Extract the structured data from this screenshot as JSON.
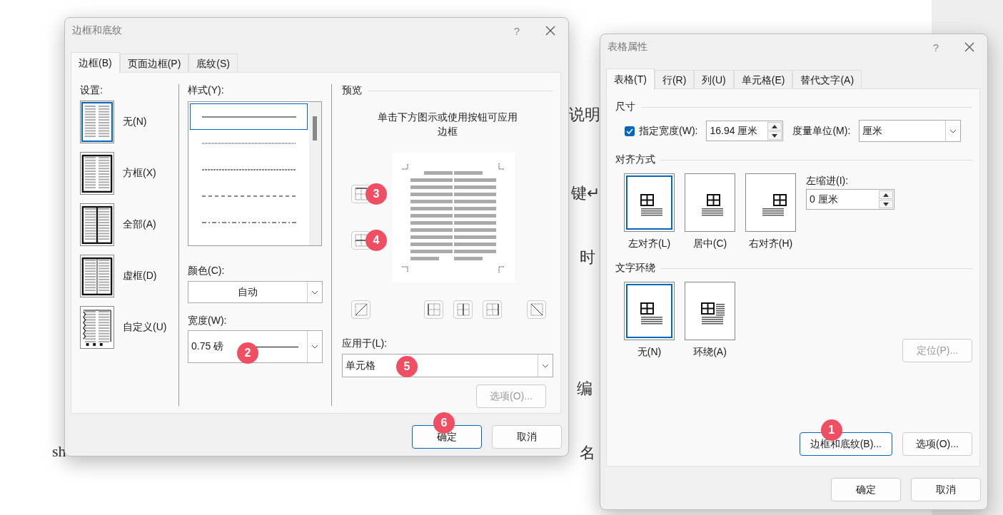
{
  "document": {
    "fragments": [
      "说明",
      "键↵",
      "时",
      "编",
      "sh",
      "名"
    ]
  },
  "border_dialog": {
    "title": "边框和底纹",
    "help": "?",
    "tabs": [
      {
        "label": "边框(B)",
        "selected": true
      },
      {
        "label": "页面边框(P)",
        "selected": false
      },
      {
        "label": "底纹(S)",
        "selected": false
      }
    ],
    "settings": {
      "label": "设置:",
      "items": [
        {
          "label": "无(N)",
          "kind": "none",
          "selected": true
        },
        {
          "label": "方框(X)",
          "kind": "box",
          "selected": false
        },
        {
          "label": "全部(A)",
          "kind": "all",
          "selected": false
        },
        {
          "label": "虚框(D)",
          "kind": "grid",
          "selected": false
        },
        {
          "label": "自定义(U)",
          "kind": "custom",
          "selected": false
        }
      ]
    },
    "style": {
      "label": "样式(Y):",
      "lines": [
        {
          "kind": "solid",
          "selected": true
        },
        {
          "kind": "dotted",
          "selected": false
        },
        {
          "kind": "fine-dash",
          "selected": false
        },
        {
          "kind": "dashed",
          "selected": false
        },
        {
          "kind": "dash-dot",
          "selected": false
        }
      ]
    },
    "color": {
      "label": "颜色(C):",
      "value": "自动"
    },
    "width": {
      "label": "宽度(W):",
      "value": "0.75 磅",
      "badge": "2"
    },
    "preview": {
      "label": "预览",
      "hint": "单击下方图示或使用按钮可应用边框",
      "side_buttons": [
        {
          "kind": "top",
          "badge": "3"
        },
        {
          "kind": "inner-horizontal",
          "badge": "4"
        }
      ]
    },
    "apply_to": {
      "label": "应用于(L):",
      "value": "单元格",
      "badge": "5"
    },
    "options_button": {
      "label": "选项(O)...",
      "disabled": true
    },
    "buttons": [
      {
        "label": "确定",
        "default": true,
        "badge": "6"
      },
      {
        "label": "取消",
        "default": false
      }
    ]
  },
  "table_dialog": {
    "title": "表格属性",
    "help": "?",
    "tabs": [
      {
        "label": "表格(T)",
        "selected": true
      },
      {
        "label": "行(R)",
        "selected": false
      },
      {
        "label": "列(U)",
        "selected": false
      },
      {
        "label": "单元格(E)",
        "selected": false
      },
      {
        "label": "替代文字(A)",
        "selected": false
      }
    ],
    "size": {
      "heading": "尺寸",
      "checkbox_label": "指定宽度(W):",
      "checked": true,
      "width": "16.94 厘米",
      "unit_label": "度量单位(M):",
      "unit": "厘米"
    },
    "alignment": {
      "heading": "对齐方式",
      "options": [
        {
          "label": "左对齐(L)",
          "kind": "left",
          "selected": true
        },
        {
          "label": "居中(C)",
          "kind": "center",
          "selected": false
        },
        {
          "label": "右对齐(H)",
          "kind": "right",
          "selected": false
        }
      ],
      "indent_label": "左缩进(I):",
      "indent": "0 厘米"
    },
    "wrapping": {
      "heading": "文字环绕",
      "options": [
        {
          "label": "无(N)",
          "kind": "none",
          "selected": true
        },
        {
          "label": "环绕(A)",
          "kind": "around",
          "selected": false
        }
      ],
      "position_button": {
        "label": "定位(P)...",
        "disabled": true
      }
    },
    "actions": [
      {
        "label": "边框和底纹(B)...",
        "default": true,
        "badge": "1"
      },
      {
        "label": "选项(O)...",
        "default": false
      }
    ],
    "buttons": [
      {
        "label": "确定",
        "default": false
      },
      {
        "label": "取消",
        "default": false
      }
    ]
  }
}
